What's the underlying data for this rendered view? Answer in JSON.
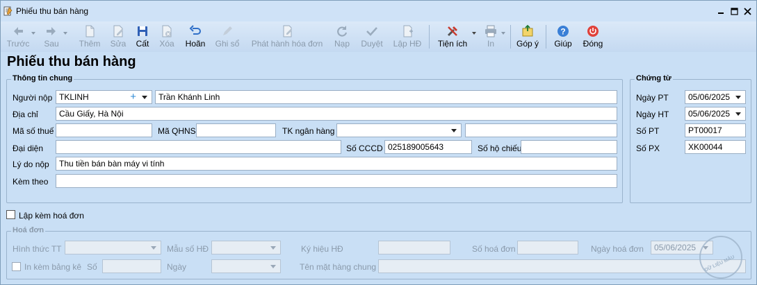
{
  "window": {
    "title": "Phiếu thu bán hàng"
  },
  "toolbar": {
    "items": [
      {
        "label": "Trước",
        "icon": "arrow-left-icon"
      },
      {
        "label": "Sau",
        "icon": "arrow-right-icon"
      },
      {
        "label": "Thêm",
        "icon": "add-document-icon"
      },
      {
        "label": "Sửa",
        "icon": "edit-document-icon"
      },
      {
        "label": "Cất",
        "icon": "save-disk-icon"
      },
      {
        "label": "Xóa",
        "icon": "delete-document-icon"
      },
      {
        "label": "Hoãn",
        "icon": "undo-icon"
      },
      {
        "label": "Ghi sổ",
        "icon": "pencil-icon"
      },
      {
        "label": "Phát hành hóa đơn",
        "icon": "issue-invoice-icon"
      },
      {
        "label": "Nạp",
        "icon": "refresh-icon"
      },
      {
        "label": "Duyệt",
        "icon": "checkmark-icon"
      },
      {
        "label": "Lập HĐ",
        "icon": "create-invoice-icon"
      },
      {
        "label": "Tiện ích",
        "icon": "tools-icon"
      },
      {
        "label": "In",
        "icon": "printer-icon"
      },
      {
        "label": "Góp ý",
        "icon": "feedback-icon"
      },
      {
        "label": "Giúp",
        "icon": "help-icon"
      },
      {
        "label": "Đóng",
        "icon": "power-icon"
      }
    ]
  },
  "page_title": "Phiếu thu bán hàng",
  "general": {
    "legend": "Thông tin chung",
    "payer_label": "Người nộp",
    "payer_code": "TKLINH",
    "payer_name": "Trần Khánh Linh",
    "address_label": "Địa chỉ",
    "address": "Cầu Giấy, Hà Nội",
    "tax_label": "Mã số thuế",
    "tax_value": "",
    "qhns_label": "Mã QHNS",
    "qhns_value": "",
    "bank_label": "TK ngân hàng",
    "bank_value": "",
    "bank_name": "",
    "rep_label": "Đại diện",
    "rep_value": "",
    "cccd_label": "Số CCCD",
    "cccd_value": "025189005643",
    "passport_label": "Số hộ chiếu",
    "passport_value": "",
    "reason_label": "Lý do nộp",
    "reason_value": "Thu tiền bán bàn máy vi tính",
    "attach_label": "Kèm theo",
    "attach_value": ""
  },
  "voucher": {
    "legend": "Chứng từ",
    "pt_date_label": "Ngày PT",
    "pt_date": "05/06/2025",
    "ht_date_label": "Ngày HT",
    "ht_date": "05/06/2025",
    "pt_no_label": "Số PT",
    "pt_no": "PT00017",
    "px_no_label": "Số PX",
    "px_no": "XK00044"
  },
  "attach_invoice": {
    "label": "Lập kèm hoá đơn",
    "checked": false
  },
  "invoice": {
    "legend": "Hoá đơn",
    "form_label": "Hình thức TT",
    "form_value": "",
    "template_label": "Mẫu số HĐ",
    "template_value": "",
    "symbol_label": "Ký hiệu HĐ",
    "symbol_value": "",
    "number_label": "Số hoá đơn",
    "number_value": "",
    "date_label": "Ngày hoá đơn",
    "date_value": "05/06/2025",
    "print_list_label": "In kèm bảng kê",
    "print_list_checked": false,
    "so_label": "Số",
    "so_value": "",
    "ngay_label": "Ngày",
    "ngay_value": "",
    "goods_label": "Tên mặt hàng chung",
    "goods_value": ""
  },
  "watermark": {
    "text": "DỮ LIỆU MẪU"
  }
}
